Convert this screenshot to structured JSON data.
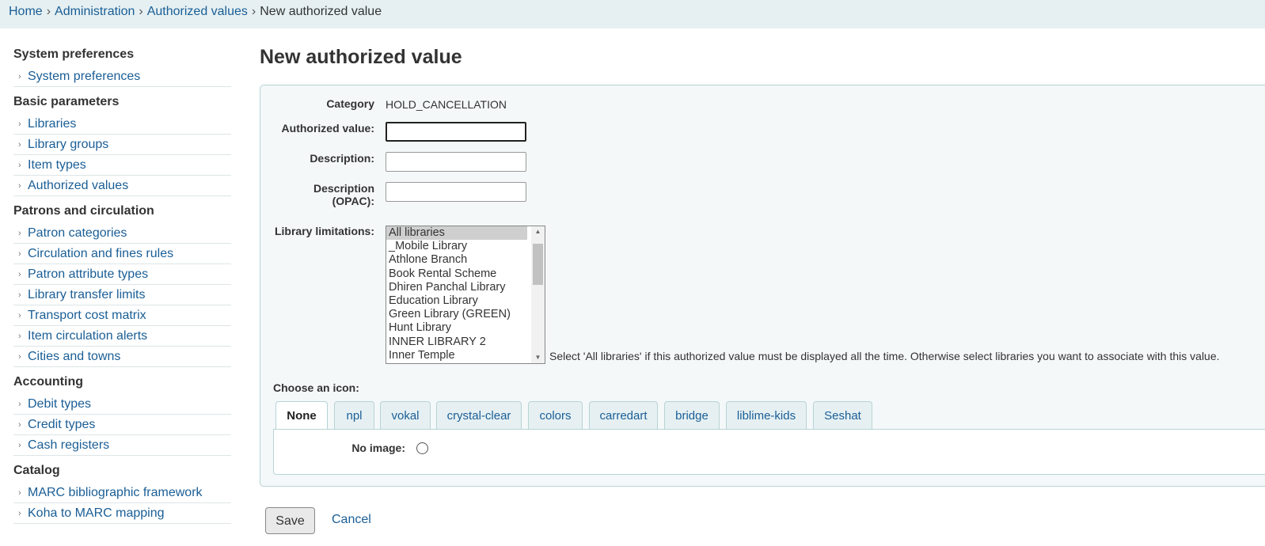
{
  "breadcrumb": {
    "items": [
      "Home",
      "Administration",
      "Authorized values"
    ],
    "separator": "›",
    "current": "New authorized value"
  },
  "sidebar": {
    "sections": [
      {
        "heading": "System preferences",
        "items": [
          "System preferences"
        ]
      },
      {
        "heading": "Basic parameters",
        "items": [
          "Libraries",
          "Library groups",
          "Item types",
          "Authorized values"
        ]
      },
      {
        "heading": "Patrons and circulation",
        "items": [
          "Patron categories",
          "Circulation and fines rules",
          "Patron attribute types",
          "Library transfer limits",
          "Transport cost matrix",
          "Item circulation alerts",
          "Cities and towns"
        ]
      },
      {
        "heading": "Accounting",
        "items": [
          "Debit types",
          "Credit types",
          "Cash registers"
        ]
      },
      {
        "heading": "Catalog",
        "items": [
          "MARC bibliographic framework",
          "Koha to MARC mapping"
        ]
      }
    ]
  },
  "page_title": "New authorized value",
  "form": {
    "category_label": "Category",
    "category_value": "HOLD_CANCELLATION",
    "authorized_value_label": "Authorized value:",
    "authorized_value": "",
    "description_label": "Description:",
    "description_value": "",
    "description_opac_label_1": "Description",
    "description_opac_label_2": "(OPAC):",
    "description_opac_value": "",
    "library_limitations_label": "Library limitations:",
    "library_options": [
      "All libraries",
      "_Mobile Library",
      "Athlone Branch",
      "Book Rental Scheme",
      "Dhiren Panchal Library",
      "Education Library",
      "Green Library (GREEN)",
      "Hunt Library",
      "INNER LIBRARY 2",
      "Inner Temple"
    ],
    "library_selected": "All libraries",
    "library_hint": "Select 'All libraries' if this authorized value must be displayed all the time. Otherwise select libraries you want to associate with this value.",
    "choose_icon_label": "Choose an icon:",
    "icon_tabs": [
      "None",
      "npl",
      "vokal",
      "crystal-clear",
      "colors",
      "carredart",
      "bridge",
      "liblime-kids",
      "Seshat"
    ],
    "active_tab": "None",
    "no_image_label": "No image:"
  },
  "actions": {
    "save_label": "Save",
    "cancel_label": "Cancel"
  },
  "colors": {
    "link": "#1a5e96",
    "breadcrumb_bg": "#e6f0f2",
    "form_bg": "#f4f8f9",
    "border": "#b8d3d6"
  }
}
